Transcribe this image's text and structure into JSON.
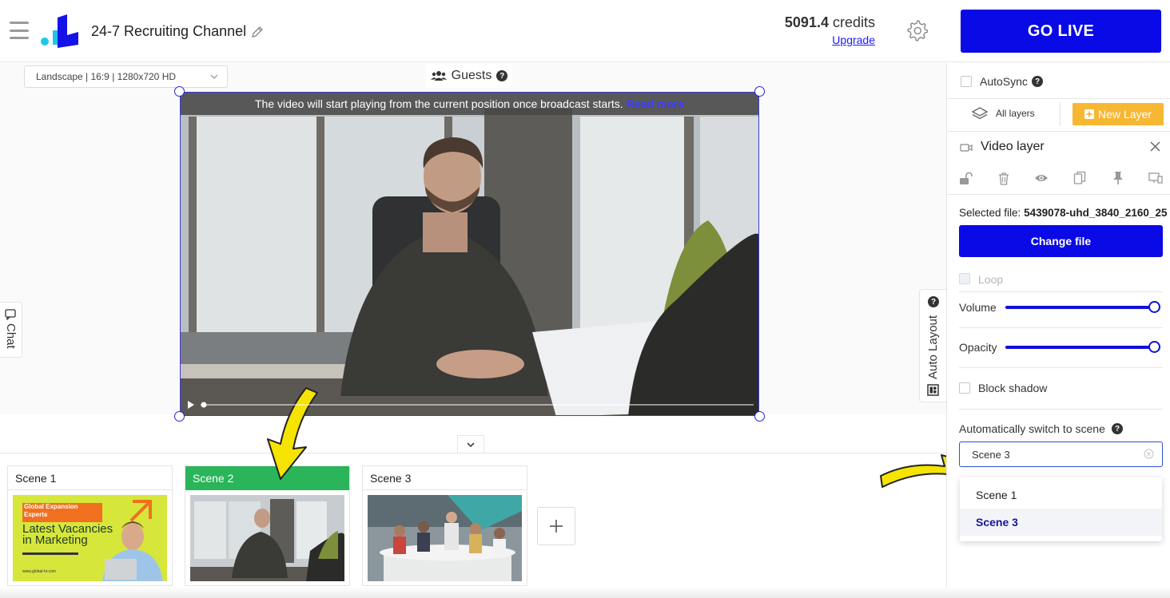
{
  "header": {
    "channel_title": "24-7 Recruiting Channel",
    "credits_amount": "5091.4",
    "credits_unit": "credits",
    "upgrade_label": "Upgrade",
    "go_live_label": "GO LIVE"
  },
  "stage": {
    "resolution_value": "Landscape | 16:9 | 1280x720 HD",
    "guests_label": "Guests",
    "notice_text": "The video will start playing from the current position once broadcast starts.",
    "notice_link": "Read more",
    "chat_label": "Chat",
    "auto_layout_label": "Auto Layout"
  },
  "scenes": [
    {
      "label": "Scene 1",
      "active": false,
      "thumb_title_1": "Global Expansion",
      "thumb_title_2": "Experts",
      "thumb_heading": "Latest Vacancies in Marketing",
      "thumb_url": "www.global-hr.com"
    },
    {
      "label": "Scene 2",
      "active": true
    },
    {
      "label": "Scene 3",
      "active": false
    }
  ],
  "panel": {
    "autosync_label": "AutoSync",
    "all_layers_label": "All layers",
    "new_layer_label": "New Layer",
    "layer_title": "Video layer",
    "selected_file_label": "Selected file:",
    "selected_file_name": "5439078-uhd_3840_2160_25",
    "change_file_label": "Change file",
    "loop_label": "Loop",
    "volume_label": "Volume",
    "volume_level": 1.0,
    "opacity_label": "Opacity",
    "opacity_level": 1.0,
    "block_shadow_label": "Block shadow",
    "auto_switch_label": "Automatically switch to scene",
    "auto_switch_value": "Scene 3",
    "auto_switch_options": [
      "Scene 1",
      "Scene 3"
    ],
    "auto_switch_selected": "Scene 3"
  },
  "colors": {
    "primary": "#0a0ae6",
    "active_scene": "#2bb55a",
    "new_layer": "#f7b733",
    "annotation_arrow": "#f5e400"
  },
  "icons": [
    "menu-icon",
    "logo",
    "pencil-icon",
    "gear-icon",
    "people-icon",
    "help-icon",
    "chevron-down-icon",
    "play-icon",
    "chat-icon",
    "auto-layout-icon",
    "plus-icon",
    "layers-icon",
    "video-camera-icon",
    "close-icon",
    "unlock-icon",
    "trash-icon",
    "eye-icon",
    "copy-icon",
    "pin-icon",
    "monitor-icon",
    "clear-icon"
  ]
}
